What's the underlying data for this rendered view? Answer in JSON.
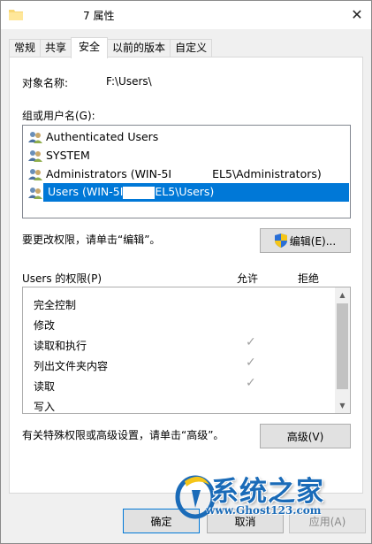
{
  "window": {
    "title_suffix": "7 属性",
    "close_glyph": "✕"
  },
  "tabs": [
    {
      "label": "常规",
      "active": false
    },
    {
      "label": "共享",
      "active": false
    },
    {
      "label": "安全",
      "active": true
    },
    {
      "label": "以前的版本",
      "active": false
    },
    {
      "label": "自定义",
      "active": false
    }
  ],
  "security": {
    "object_name_label": "对象名称:",
    "object_name_value": "F:\\Users\\",
    "group_label": "组或用户名(G):",
    "users": [
      {
        "name": "Authenticated Users",
        "icon": "users-group-icon",
        "selected": false
      },
      {
        "name": "SYSTEM",
        "icon": "users-group-icon",
        "selected": false
      },
      {
        "name_prefix": "Administrators (WIN-5I",
        "name_suffix": "EL5\\Administrators)",
        "icon": "users-group-icon",
        "selected": false
      },
      {
        "name_prefix": "Users (WIN-5I",
        "name_suffix": "EL5\\Users)",
        "icon": "users-group-icon",
        "selected": true
      }
    ],
    "change_hint": "要更改权限，请单击“编辑”。",
    "edit_button": "编辑(E)...",
    "permissions_label": "Users 的权限(P)",
    "allow_header": "允许",
    "deny_header": "拒绝",
    "permissions": [
      {
        "name": "完全控制",
        "allow": false,
        "deny": false
      },
      {
        "name": "修改",
        "allow": false,
        "deny": false
      },
      {
        "name": "读取和执行",
        "allow": true,
        "deny": false
      },
      {
        "name": "列出文件夹内容",
        "allow": true,
        "deny": false
      },
      {
        "name": "读取",
        "allow": true,
        "deny": false
      },
      {
        "name": "写入",
        "allow": false,
        "deny": false
      }
    ],
    "check_glyph": "✓",
    "advanced_hint": "有关特殊权限或高级设置，请单击“高级”。",
    "advanced_button": "高级(V)"
  },
  "footer": {
    "ok_button": "确定",
    "cancel_button": "取消",
    "apply_button": "应用(A)"
  },
  "watermark": {
    "main_text": "系统之家",
    "url_text": "www.Ghost123.com"
  },
  "colors": {
    "selection": "#0078d7",
    "check_disabled": "#a0a0a0",
    "watermark": "#1a6bb8"
  }
}
